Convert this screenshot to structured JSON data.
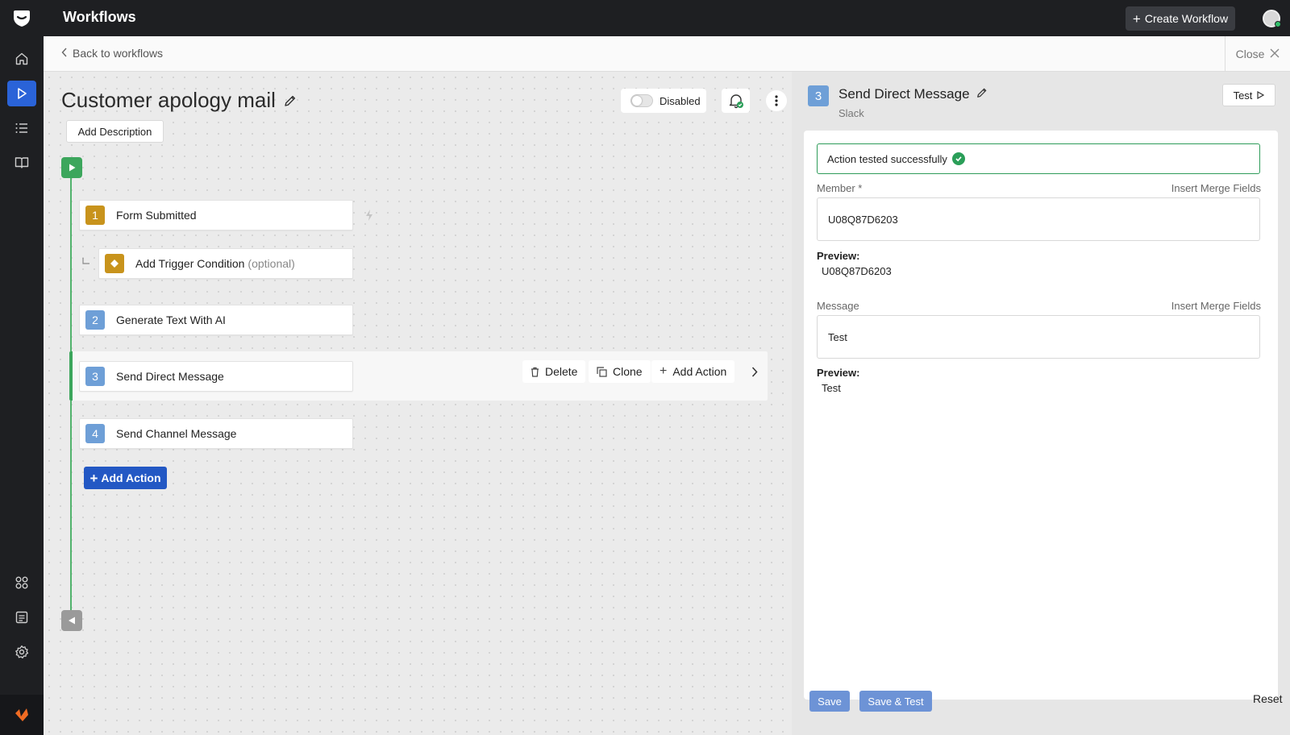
{
  "app": {
    "title": "Workflows",
    "create_button": "Create Workflow"
  },
  "breadcrumb": {
    "back_label": "Back to workflows",
    "close_label": "Close"
  },
  "workflow": {
    "title": "Customer apology mail",
    "add_description": "Add Description",
    "status_label": "Disabled",
    "steps": [
      {
        "number": "1",
        "label": "Form Submitted"
      },
      {
        "label": "Add Trigger Condition",
        "optional": "(optional)"
      },
      {
        "number": "2",
        "label": "Generate Text With AI"
      },
      {
        "number": "3",
        "label": "Send Direct Message"
      },
      {
        "number": "4",
        "label": "Send Channel Message"
      }
    ],
    "row_actions": {
      "delete": "Delete",
      "clone": "Clone",
      "add_action": "Add Action"
    },
    "add_action_button": "Add Action"
  },
  "panel": {
    "step_number": "3",
    "title": "Send Direct Message",
    "subtitle": "Slack",
    "test_button": "Test",
    "success_message": "Action tested successfully",
    "member": {
      "label": "Member *",
      "merge": "Insert Merge Fields",
      "value": "U08Q87D6203",
      "preview_label": "Preview:",
      "preview_value": "U08Q87D6203"
    },
    "message": {
      "label": "Message",
      "merge": "Insert Merge Fields",
      "value": "Test",
      "preview_label": "Preview:",
      "preview_value": "Test"
    },
    "save": "Save",
    "save_test": "Save & Test",
    "reset": "Reset"
  },
  "colors": {
    "accent": "#2358c4",
    "success": "#3ca65c",
    "step_gold": "#c8931c",
    "step_blue": "#6e9fd7"
  }
}
